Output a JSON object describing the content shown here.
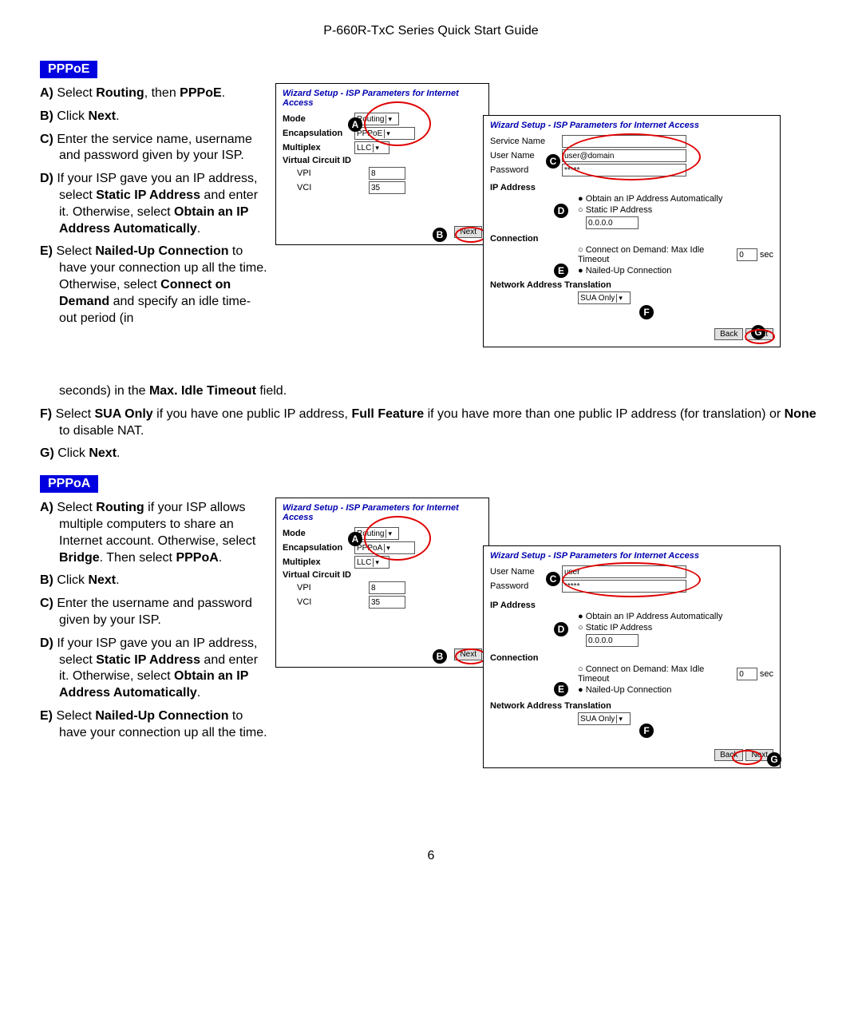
{
  "header": "P-660R-TxC Series Quick Start Guide",
  "page_number": "6",
  "pppoe": {
    "tag": "PPPoE",
    "steps": {
      "a": "Select <b>Routing</b>, then <b>PPPoE</b>.",
      "b": "Click <b>Next</b>.",
      "c": "Enter the service name, username and password given by your ISP.",
      "d": "If your ISP gave you an IP address, select <b>Static IP Address</b> and enter it. Otherwise, select <b>Obtain an IP Address Automatically</b>.",
      "e_part1": "Select <b>Nailed-Up Connection</b> to have your connection up all the time. Otherwise, select <b>Connect on Demand</b> and specify an idle time-out period (in",
      "e_part2": "seconds) in the <b>Max. Idle Timeout</b> field.",
      "f": "Select <b>SUA Only</b> if you have one public IP address, <b>Full Feature</b> if you have more than one public IP address (for translation) or <b>None</b> to disable NAT.",
      "g": "Click <b>Next</b>."
    },
    "wiz1": {
      "title": "Wizard Setup - ISP Parameters for Internet Access",
      "mode_lbl": "Mode",
      "mode_val": "Routing",
      "encap_lbl": "Encapsulation",
      "encap_val": "PPPoE",
      "mux_lbl": "Multiplex",
      "mux_val": "LLC",
      "vc_lbl": "Virtual Circuit ID",
      "vpi_lbl": "VPI",
      "vpi_val": "8",
      "vci_lbl": "VCI",
      "vci_val": "35",
      "next": "Next"
    },
    "wiz2": {
      "title": "Wizard Setup - ISP Parameters for Internet Access",
      "svc_lbl": "Service Name",
      "svc_val": "",
      "user_lbl": "User Name",
      "user_val": "user@domain",
      "pwd_lbl": "Password",
      "pwd_val": "*****",
      "ip_lbl": "IP Address",
      "ip_auto": "Obtain an IP Address Automatically",
      "ip_static": "Static IP Address",
      "ip_val": "0.0.0.0",
      "conn_lbl": "Connection",
      "conn_demand": "Connect on Demand: Max Idle Timeout",
      "conn_timeout": "0",
      "sec": "sec",
      "conn_nailed": "Nailed-Up Connection",
      "nat_lbl": "Network Address Translation",
      "nat_val": "SUA Only",
      "back": "Back",
      "next": "Next"
    }
  },
  "pppoa": {
    "tag": "PPPoA",
    "steps": {
      "a": "Select <b>Routing</b> if your ISP allows multiple computers to share an Internet account. Otherwise, select <b>Bridge</b>. Then select <b>PPPoA</b>.",
      "b": "Click <b>Next</b>.",
      "c": "Enter the username and password given by your ISP.",
      "d": "If your ISP gave you an IP address, select <b>Static IP Address</b> and enter it. Otherwise, select <b>Obtain an IP Address Automatically</b>.",
      "e": "Select <b>Nailed-Up Connection</b> to have your connection up all the time."
    },
    "wiz1": {
      "title": "Wizard Setup - ISP Parameters for Internet Access",
      "mode_lbl": "Mode",
      "mode_val": "Routing",
      "encap_lbl": "Encapsulation",
      "encap_val": "PPPoA",
      "mux_lbl": "Multiplex",
      "mux_val": "LLC",
      "vc_lbl": "Virtual Circuit ID",
      "vpi_lbl": "VPI",
      "vpi_val": "8",
      "vci_lbl": "VCI",
      "vci_val": "35",
      "next": "Next"
    },
    "wiz2": {
      "title": "Wizard Setup - ISP Parameters for Internet Access",
      "user_lbl": "User Name",
      "user_val": "user",
      "pwd_lbl": "Password",
      "pwd_val": "*****",
      "ip_lbl": "IP Address",
      "ip_auto": "Obtain an IP Address Automatically",
      "ip_static": "Static IP Address",
      "ip_val": "0.0.0.0",
      "conn_lbl": "Connection",
      "conn_demand": "Connect on Demand: Max Idle Timeout",
      "conn_timeout": "0",
      "sec": "sec",
      "conn_nailed": "Nailed-Up Connection",
      "nat_lbl": "Network Address Translation",
      "nat_val": "SUA Only",
      "back": "Back",
      "next": "Next"
    }
  }
}
